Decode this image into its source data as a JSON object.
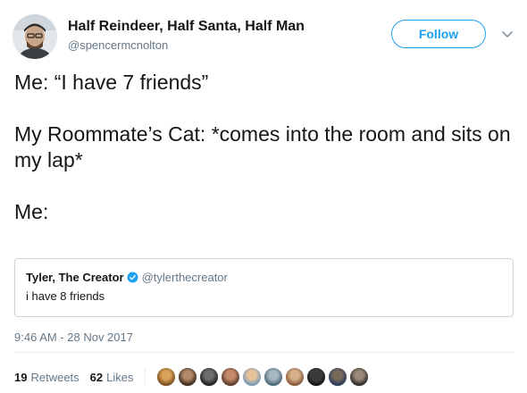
{
  "author": {
    "display_name": "Half Reindeer, Half Santa, Half Man",
    "handle": "@spencermcnolton",
    "follow_label": "Follow"
  },
  "tweet": {
    "lines": [
      "Me: “I have 7 friends”",
      "My Roommate’s Cat: *comes into the room and sits on my lap*",
      "Me:"
    ]
  },
  "quoted": {
    "name": "Tyler, The Creator",
    "handle": "@tylerthecreator",
    "text": "i have 8 friends"
  },
  "timestamp": "9:46 AM - 28 Nov 2017",
  "stats": {
    "retweets_count": "19",
    "retweets_label": "Retweets",
    "likes_count": "62",
    "likes_label": "Likes"
  },
  "liker_avatars": [
    "avatar-1",
    "avatar-2",
    "avatar-3",
    "avatar-4",
    "avatar-5",
    "avatar-6",
    "avatar-7",
    "avatar-8",
    "avatar-9",
    "avatar-10"
  ],
  "colors": {
    "accent": "#1da1f2",
    "verified": "#1da1f2",
    "secondary_text": "#657786"
  }
}
